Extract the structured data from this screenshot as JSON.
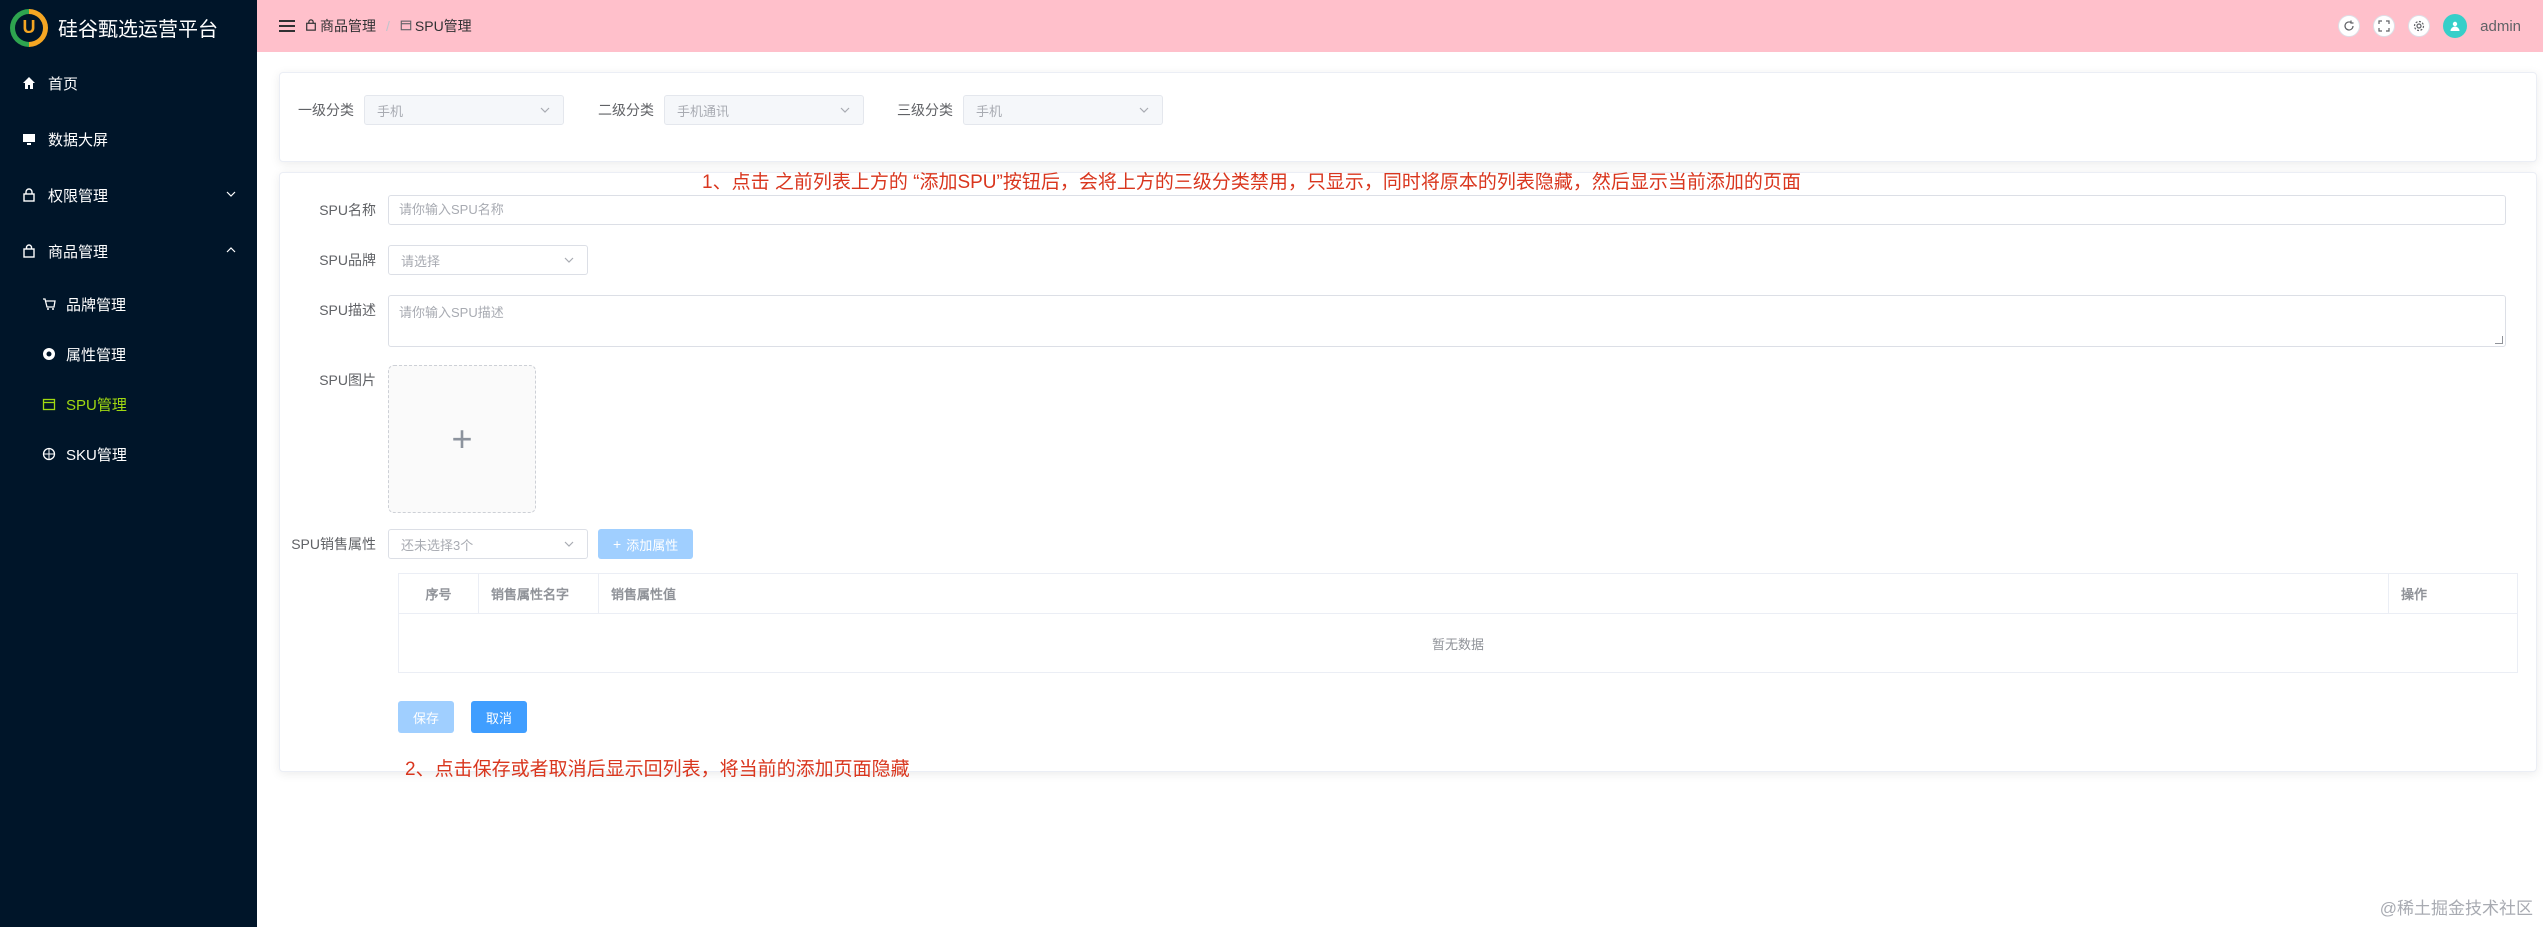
{
  "app": {
    "title": "硅谷甄选运营平台",
    "logo_letter": "U"
  },
  "sidebar": {
    "items": [
      {
        "label": "首页",
        "icon": "home-icon"
      },
      {
        "label": "数据大屏",
        "icon": "monitor-icon"
      },
      {
        "label": "权限管理",
        "icon": "lock-icon"
      },
      {
        "label": "商品管理",
        "icon": "bag-icon"
      }
    ],
    "sub_items": [
      {
        "label": "品牌管理",
        "icon": "cart-icon"
      },
      {
        "label": "属性管理",
        "icon": "chrome-icon"
      },
      {
        "label": "SPU管理",
        "icon": "calendar-icon"
      },
      {
        "label": "SKU管理",
        "icon": "orange-icon"
      }
    ]
  },
  "header": {
    "breadcrumb": [
      "商品管理",
      "SPU管理"
    ],
    "username": "admin"
  },
  "category": {
    "level1": {
      "label": "一级分类",
      "value": "手机"
    },
    "level2": {
      "label": "二级分类",
      "value": "手机通讯"
    },
    "level3": {
      "label": "三级分类",
      "value": "手机"
    }
  },
  "form": {
    "name_label": "SPU名称",
    "name_placeholder": "请你输入SPU名称",
    "brand_label": "SPU品牌",
    "brand_placeholder": "请选择",
    "desc_label": "SPU描述",
    "desc_placeholder": "请你输入SPU描述",
    "image_label": "SPU图片",
    "sale_attr_label": "SPU销售属性",
    "sale_attr_placeholder": "还未选择3个",
    "add_attr_button": "添加属性"
  },
  "table": {
    "columns": [
      "序号",
      "销售属性名字",
      "销售属性值",
      "操作"
    ],
    "empty_text": "暂无数据"
  },
  "buttons": {
    "save": "保存",
    "cancel": "取消"
  },
  "annotations": {
    "note1": "1、点击 之前列表上方的 “添加SPU”按钮后，会将上方的三级分类禁用，只显示，同时将原本的列表隐藏，然后显示当前添加的页面",
    "note2": "2、点击保存或者取消后显示回列表，将当前的添加页面隐藏"
  },
  "watermark": "@稀土掘金技术社区"
}
